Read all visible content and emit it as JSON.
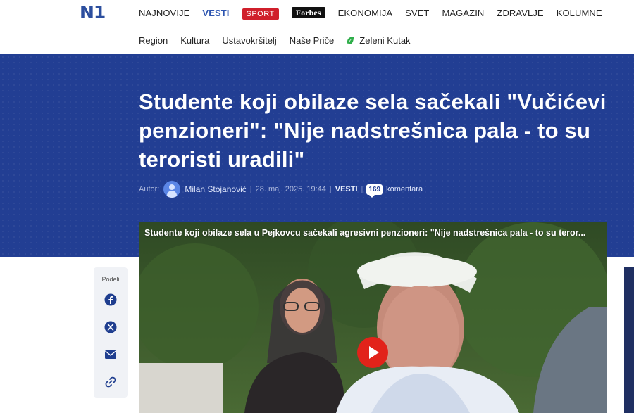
{
  "header": {
    "logo": "N1",
    "nav": [
      {
        "label": "NAJNOVIJE",
        "type": "text"
      },
      {
        "label": "VESTI",
        "type": "active"
      },
      {
        "label": "SPORT",
        "type": "badge-sport"
      },
      {
        "label": "Forbes",
        "type": "badge-forbes"
      },
      {
        "label": "EKONOMIJA",
        "type": "text"
      },
      {
        "label": "SVET",
        "type": "text"
      },
      {
        "label": "MAGAZIN",
        "type": "text"
      },
      {
        "label": "ZDRAVLJE",
        "type": "text"
      },
      {
        "label": "KOLUMNE",
        "type": "text"
      }
    ]
  },
  "subnav": {
    "items": [
      "Region",
      "Kultura",
      "Ustavokršitelj",
      "Naše Priče"
    ],
    "green": {
      "label": "Zeleni Kutak",
      "icon": "leaf-icon"
    }
  },
  "article": {
    "headline": "Studente koji obilaze sela sačekali \"Vučićevi penzioneri\": \"Nije nadstrešnica pala - to su teroristi uradili\"",
    "meta": {
      "author_label": "Autor:",
      "author": "Milan Stojanović",
      "date": "28. maj. 2025. 19:44",
      "category": "VESTI",
      "comments_count": "169",
      "comments_label": "komentara"
    }
  },
  "share": {
    "label": "Podeli",
    "buttons": [
      "facebook-icon",
      "x-icon",
      "email-icon",
      "link-icon"
    ]
  },
  "video": {
    "title": "Studente koji obilaze sela u Pejkovcu sačekali agresivni penzioneri: \"Nije nadstrešnica pala - to su teror..."
  },
  "colors": {
    "brand": "#223e93",
    "logo": "#2c4e9e",
    "active_nav": "#2d55b0",
    "sport": "#d01f2b",
    "play": "#e2231a"
  }
}
